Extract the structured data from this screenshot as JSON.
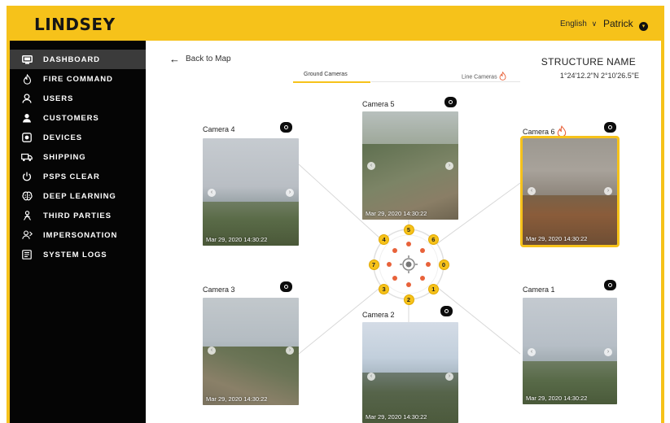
{
  "app": {
    "logo": "LINDSEY",
    "language": "English",
    "language_chevron": "∨",
    "user_name": "Patrick",
    "user_chevron": "⌄"
  },
  "sidebar": {
    "items": [
      {
        "label": "DASHBOARD",
        "icon": "monitor-icon",
        "active": true
      },
      {
        "label": "FIRE COMMAND",
        "icon": "flame-icon",
        "active": false
      },
      {
        "label": "USERS",
        "icon": "user-icon",
        "active": false
      },
      {
        "label": "CUSTOMERS",
        "icon": "customer-icon",
        "active": false
      },
      {
        "label": "DEVICES",
        "icon": "device-icon",
        "active": false
      },
      {
        "label": "SHIPPING",
        "icon": "truck-icon",
        "active": false
      },
      {
        "label": "PSPS CLEAR",
        "icon": "power-icon",
        "active": false
      },
      {
        "label": "DEEP LEARNING",
        "icon": "brain-icon",
        "active": false
      },
      {
        "label": "THIRD PARTIES",
        "icon": "people-icon",
        "active": false
      },
      {
        "label": "IMPERSONATION",
        "icon": "impersonation-icon",
        "active": false
      },
      {
        "label": "SYSTEM LOGS",
        "icon": "logs-icon",
        "active": false
      }
    ]
  },
  "main": {
    "back_label": "Back to Map",
    "structure_name": "STRUCTURE NAME",
    "coordinates": "1°24'12.2\"N 2°10'26.5\"E",
    "tabs": {
      "ground": "Ground Cameras",
      "line": "Line Cameras"
    },
    "cameras": {
      "cam4": {
        "label": "Camera 4",
        "timestamp": "Mar 29, 2020  14:30:22"
      },
      "cam5": {
        "label": "Camera 5",
        "timestamp": "Mar 29, 2020  14:30:22"
      },
      "cam6": {
        "label": "Camera 6",
        "timestamp": "Mar 29, 2020  14:30:22",
        "fire": true
      },
      "cam3": {
        "label": "Camera 3",
        "timestamp": "Mar 29, 2020  14:30:22"
      },
      "cam2": {
        "label": "Camera 2",
        "timestamp": "Mar 29, 2020  14:30:22"
      },
      "cam1": {
        "label": "Camera 1",
        "timestamp": "Mar 29, 2020  14:30:22"
      }
    },
    "compass_markers": [
      "5",
      "6",
      "0",
      "1",
      "2",
      "3",
      "7",
      "4"
    ]
  },
  "colors": {
    "accent": "#f6c21a",
    "sidebar_bg": "#050505",
    "active_item": "#3b3b3b",
    "fire": "#e8623a"
  }
}
